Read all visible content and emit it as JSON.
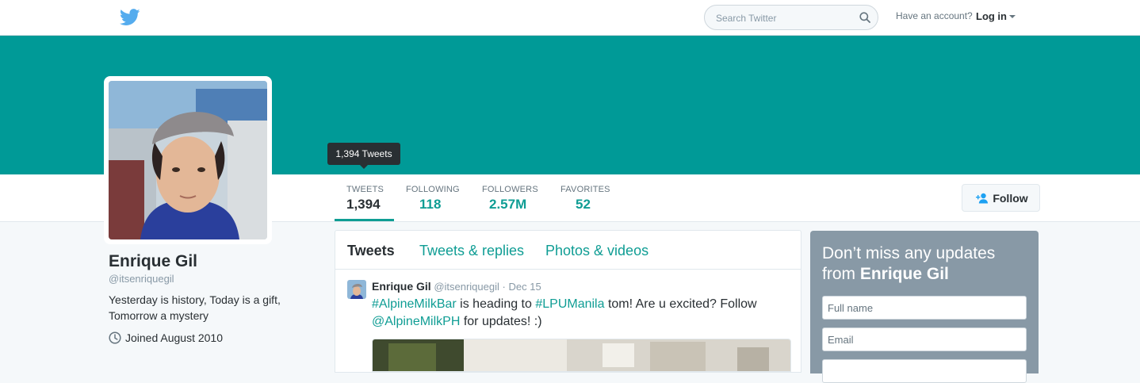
{
  "colors": {
    "accent": "#0f9d94",
    "banner": "#009a97",
    "signup_panel": "#8899a6"
  },
  "topbar": {
    "logo_icon": "twitter-bird-icon",
    "search_placeholder": "Search Twitter",
    "search_icon": "search-icon",
    "account_prompt": "Have an account?",
    "login_label": "Log in"
  },
  "stats": {
    "tooltip": "1,394 Tweets",
    "tweets": {
      "label": "TWEETS",
      "value": "1,394"
    },
    "following": {
      "label": "FOLLOWING",
      "value": "118"
    },
    "followers": {
      "label": "FOLLOWERS",
      "value": "2.57M"
    },
    "favorites": {
      "label": "FAVORITES",
      "value": "52"
    }
  },
  "follow_button": {
    "label": "Follow",
    "icon": "add-user-icon"
  },
  "profile": {
    "name": "Enrique Gil",
    "handle": "@itsenriquegil",
    "bio_line1": "Yesterday is history, Today is a gift,",
    "bio_line2": "Tomorrow a mystery",
    "joined": "Joined August 2010",
    "joined_icon": "clock-icon"
  },
  "timeline": {
    "tabs": [
      "Tweets",
      "Tweets & replies",
      "Photos & videos"
    ],
    "active_tab": "Tweets",
    "tweet": {
      "name": "Enrique Gil",
      "handle": "@itsenriquegil",
      "separator": "·",
      "date": "Dec 15",
      "hashtag1": "#AlpineMilkBar",
      "text1": " is heading to ",
      "hashtag2": "#LPUManila",
      "text2": " tom! Are u excited? Follow ",
      "mention": "@AlpineMilkPH",
      "text3": " for updates! :)"
    }
  },
  "signup": {
    "heading_prefix": "Don’t miss any updates from ",
    "heading_name": "Enrique Gil",
    "fullname_placeholder": "Full name",
    "email_placeholder": "Email"
  }
}
